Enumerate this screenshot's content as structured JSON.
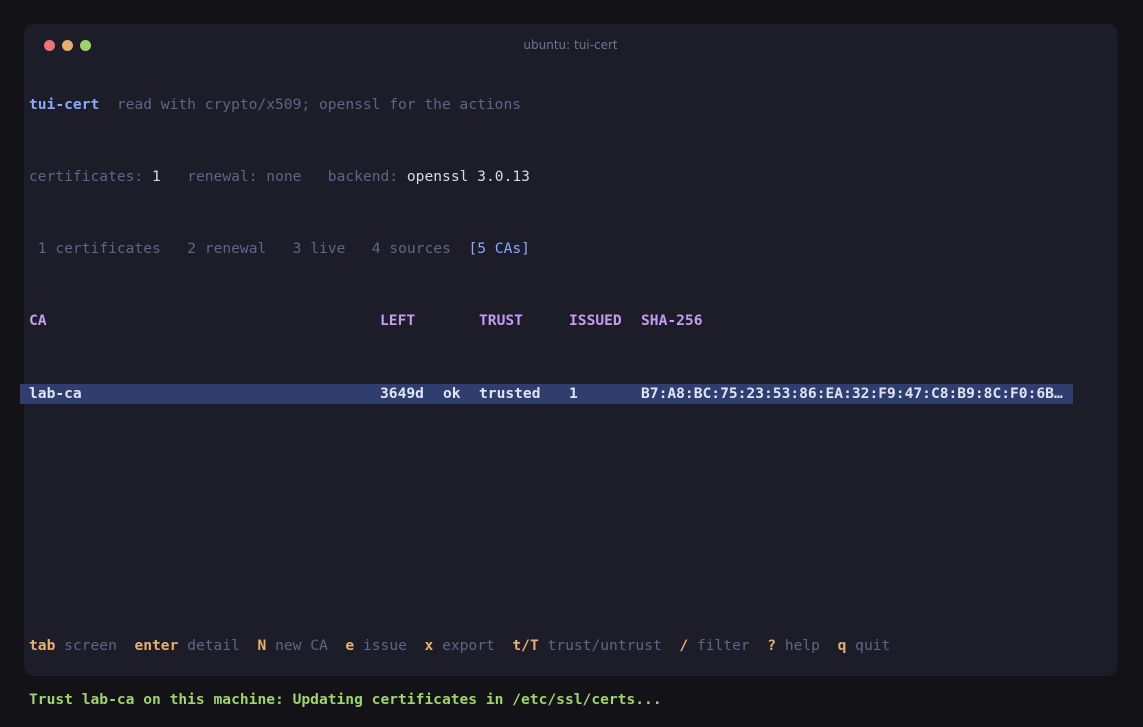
{
  "window": {
    "title": "ubuntu: tui-cert"
  },
  "header": {
    "app_name": "tui-cert",
    "tagline": "read with crypto/x509; openssl for the actions",
    "certificates_label": "certificates:",
    "certificates_value": "1",
    "renewal_label": "renewal:",
    "renewal_value": "none",
    "backend_label": "backend:",
    "backend_value": "openssl 3.0.13"
  },
  "tabs": [
    {
      "num": "1",
      "label": "certificates"
    },
    {
      "num": "2",
      "label": "renewal"
    },
    {
      "num": "3",
      "label": "live"
    },
    {
      "num": "4",
      "label": "sources"
    },
    {
      "label": "[5 CAs]"
    }
  ],
  "table": {
    "columns": [
      "CA",
      "LEFT",
      "TRUST",
      "ISSUED",
      "SHA-256"
    ],
    "rows": [
      {
        "ca": "lab-ca",
        "left": "3649d",
        "left_status": "ok",
        "trust": "trusted",
        "issued": "1",
        "sha256": "B7:A8:BC:75:23:53:86:EA:32:F9:47:C8:B9:8C:F0:6B…"
      }
    ]
  },
  "footer": {
    "keys": [
      {
        "key": "tab",
        "desc": "screen"
      },
      {
        "key": "enter",
        "desc": "detail"
      },
      {
        "key": "N",
        "desc": "new CA"
      },
      {
        "key": "e",
        "desc": "issue"
      },
      {
        "key": "x",
        "desc": "export"
      },
      {
        "key": "t/T",
        "desc": "trust/untrust"
      },
      {
        "key": "/",
        "desc": "filter"
      },
      {
        "key": "?",
        "desc": "help"
      },
      {
        "key": "q",
        "desc": "quit"
      }
    ],
    "status": "Trust lab-ca on this machine: Updating certificates in /etc/ssl/certs..."
  },
  "colors": {
    "background": "#1c1d29",
    "accent": "#8aa8ff",
    "header": "#c59cf0",
    "key": "#e6b070",
    "status": "#9fd46b",
    "selection": "#2f3e6e"
  }
}
